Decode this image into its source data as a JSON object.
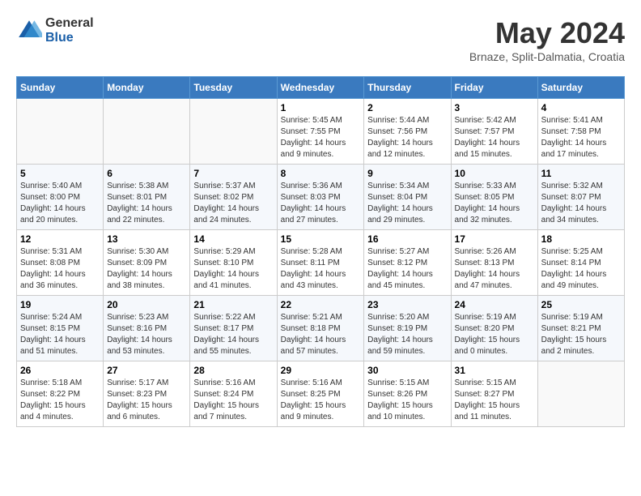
{
  "header": {
    "logo_general": "General",
    "logo_blue": "Blue",
    "month_title": "May 2024",
    "location": "Brnaze, Split-Dalmatia, Croatia"
  },
  "days_of_week": [
    "Sunday",
    "Monday",
    "Tuesday",
    "Wednesday",
    "Thursday",
    "Friday",
    "Saturday"
  ],
  "weeks": [
    [
      {
        "day": "",
        "info": ""
      },
      {
        "day": "",
        "info": ""
      },
      {
        "day": "",
        "info": ""
      },
      {
        "day": "1",
        "info": "Sunrise: 5:45 AM\nSunset: 7:55 PM\nDaylight: 14 hours\nand 9 minutes."
      },
      {
        "day": "2",
        "info": "Sunrise: 5:44 AM\nSunset: 7:56 PM\nDaylight: 14 hours\nand 12 minutes."
      },
      {
        "day": "3",
        "info": "Sunrise: 5:42 AM\nSunset: 7:57 PM\nDaylight: 14 hours\nand 15 minutes."
      },
      {
        "day": "4",
        "info": "Sunrise: 5:41 AM\nSunset: 7:58 PM\nDaylight: 14 hours\nand 17 minutes."
      }
    ],
    [
      {
        "day": "5",
        "info": "Sunrise: 5:40 AM\nSunset: 8:00 PM\nDaylight: 14 hours\nand 20 minutes."
      },
      {
        "day": "6",
        "info": "Sunrise: 5:38 AM\nSunset: 8:01 PM\nDaylight: 14 hours\nand 22 minutes."
      },
      {
        "day": "7",
        "info": "Sunrise: 5:37 AM\nSunset: 8:02 PM\nDaylight: 14 hours\nand 24 minutes."
      },
      {
        "day": "8",
        "info": "Sunrise: 5:36 AM\nSunset: 8:03 PM\nDaylight: 14 hours\nand 27 minutes."
      },
      {
        "day": "9",
        "info": "Sunrise: 5:34 AM\nSunset: 8:04 PM\nDaylight: 14 hours\nand 29 minutes."
      },
      {
        "day": "10",
        "info": "Sunrise: 5:33 AM\nSunset: 8:05 PM\nDaylight: 14 hours\nand 32 minutes."
      },
      {
        "day": "11",
        "info": "Sunrise: 5:32 AM\nSunset: 8:07 PM\nDaylight: 14 hours\nand 34 minutes."
      }
    ],
    [
      {
        "day": "12",
        "info": "Sunrise: 5:31 AM\nSunset: 8:08 PM\nDaylight: 14 hours\nand 36 minutes."
      },
      {
        "day": "13",
        "info": "Sunrise: 5:30 AM\nSunset: 8:09 PM\nDaylight: 14 hours\nand 38 minutes."
      },
      {
        "day": "14",
        "info": "Sunrise: 5:29 AM\nSunset: 8:10 PM\nDaylight: 14 hours\nand 41 minutes."
      },
      {
        "day": "15",
        "info": "Sunrise: 5:28 AM\nSunset: 8:11 PM\nDaylight: 14 hours\nand 43 minutes."
      },
      {
        "day": "16",
        "info": "Sunrise: 5:27 AM\nSunset: 8:12 PM\nDaylight: 14 hours\nand 45 minutes."
      },
      {
        "day": "17",
        "info": "Sunrise: 5:26 AM\nSunset: 8:13 PM\nDaylight: 14 hours\nand 47 minutes."
      },
      {
        "day": "18",
        "info": "Sunrise: 5:25 AM\nSunset: 8:14 PM\nDaylight: 14 hours\nand 49 minutes."
      }
    ],
    [
      {
        "day": "19",
        "info": "Sunrise: 5:24 AM\nSunset: 8:15 PM\nDaylight: 14 hours\nand 51 minutes."
      },
      {
        "day": "20",
        "info": "Sunrise: 5:23 AM\nSunset: 8:16 PM\nDaylight: 14 hours\nand 53 minutes."
      },
      {
        "day": "21",
        "info": "Sunrise: 5:22 AM\nSunset: 8:17 PM\nDaylight: 14 hours\nand 55 minutes."
      },
      {
        "day": "22",
        "info": "Sunrise: 5:21 AM\nSunset: 8:18 PM\nDaylight: 14 hours\nand 57 minutes."
      },
      {
        "day": "23",
        "info": "Sunrise: 5:20 AM\nSunset: 8:19 PM\nDaylight: 14 hours\nand 59 minutes."
      },
      {
        "day": "24",
        "info": "Sunrise: 5:19 AM\nSunset: 8:20 PM\nDaylight: 15 hours\nand 0 minutes."
      },
      {
        "day": "25",
        "info": "Sunrise: 5:19 AM\nSunset: 8:21 PM\nDaylight: 15 hours\nand 2 minutes."
      }
    ],
    [
      {
        "day": "26",
        "info": "Sunrise: 5:18 AM\nSunset: 8:22 PM\nDaylight: 15 hours\nand 4 minutes."
      },
      {
        "day": "27",
        "info": "Sunrise: 5:17 AM\nSunset: 8:23 PM\nDaylight: 15 hours\nand 6 minutes."
      },
      {
        "day": "28",
        "info": "Sunrise: 5:16 AM\nSunset: 8:24 PM\nDaylight: 15 hours\nand 7 minutes."
      },
      {
        "day": "29",
        "info": "Sunrise: 5:16 AM\nSunset: 8:25 PM\nDaylight: 15 hours\nand 9 minutes."
      },
      {
        "day": "30",
        "info": "Sunrise: 5:15 AM\nSunset: 8:26 PM\nDaylight: 15 hours\nand 10 minutes."
      },
      {
        "day": "31",
        "info": "Sunrise: 5:15 AM\nSunset: 8:27 PM\nDaylight: 15 hours\nand 11 minutes."
      },
      {
        "day": "",
        "info": ""
      }
    ]
  ]
}
